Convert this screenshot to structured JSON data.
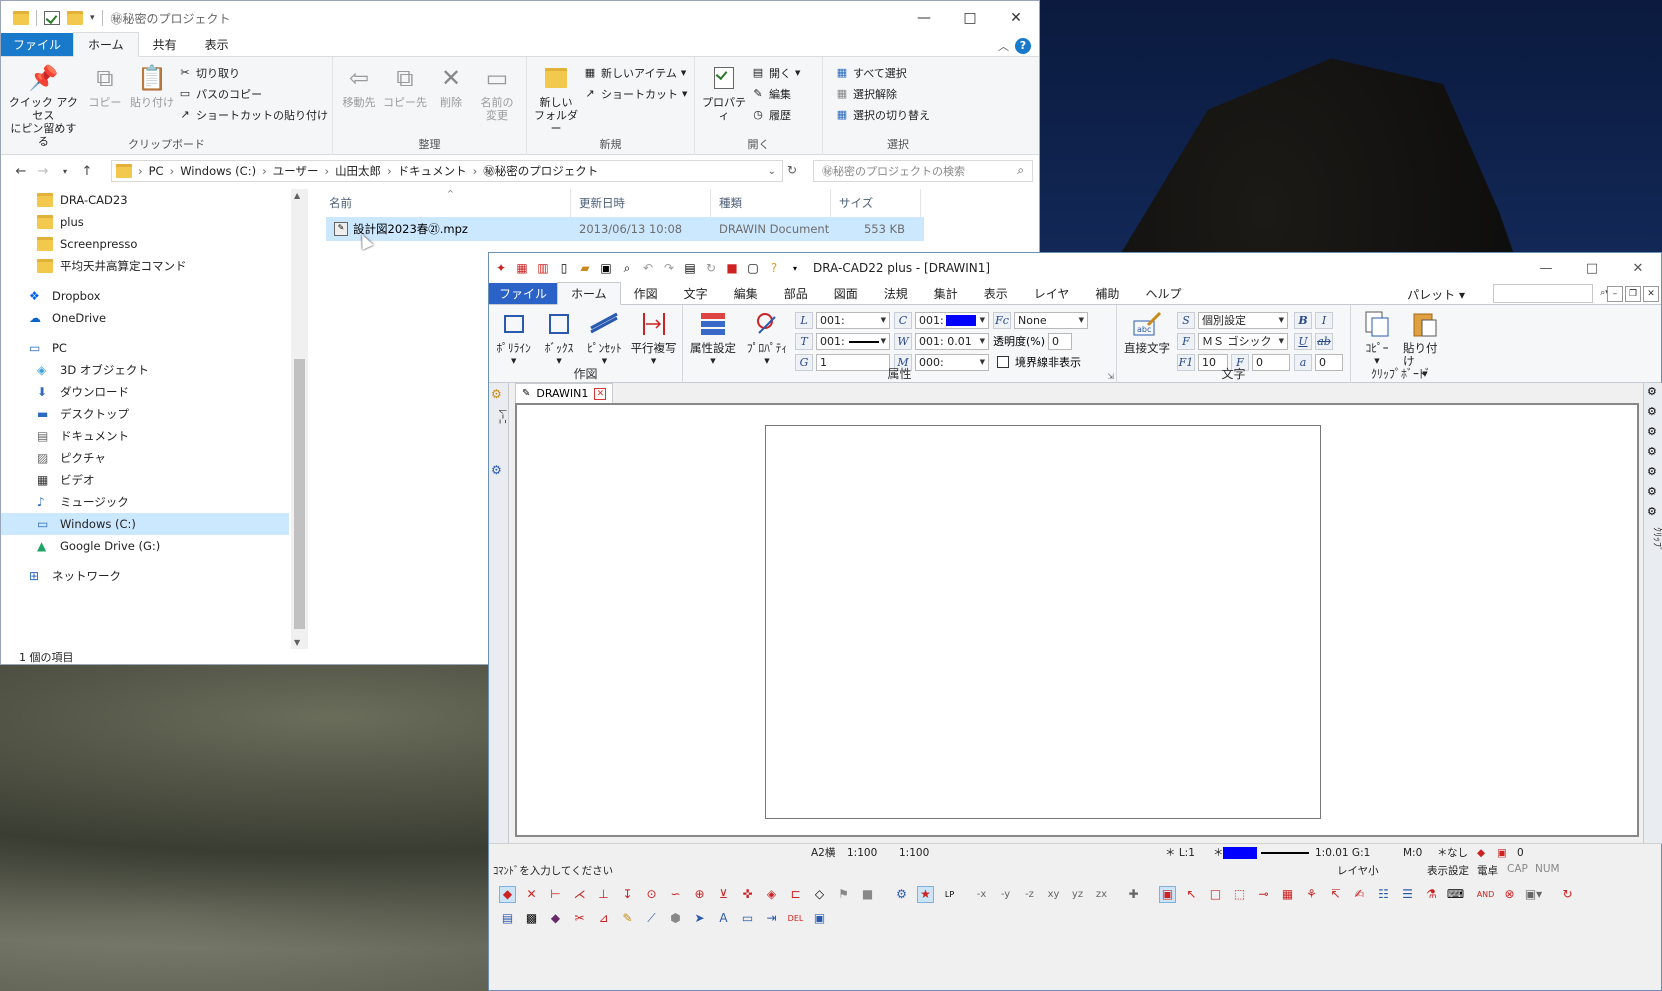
{
  "explorer": {
    "title": "㊙秘密のプロジェクト",
    "tabs": [
      "ファイル",
      "ホーム",
      "共有",
      "表示"
    ],
    "ribbon": {
      "clipboard": {
        "label": "クリップボード",
        "pin": "クイック アクセス\nにピン留めする",
        "copy": "コピー",
        "paste": "貼り付け",
        "cut": "切り取り",
        "copy_path": "パスのコピー",
        "paste_shortcut": "ショートカットの貼り付け"
      },
      "organize": {
        "label": "整理",
        "move_to": "移動先",
        "copy_to": "コピー先",
        "delete": "削除",
        "rename": "名前の\n変更"
      },
      "new": {
        "label": "新規",
        "new_folder": "新しい\nフォルダー",
        "new_item": "新しいアイテム",
        "shortcut": "ショートカット"
      },
      "open": {
        "label": "開く",
        "properties": "プロパティ",
        "open": "開く",
        "edit": "編集",
        "history": "履歴"
      },
      "select": {
        "label": "選択",
        "select_all": "すべて選択",
        "select_none": "選択解除",
        "invert": "選択の切り替え"
      }
    },
    "address": {
      "parts": [
        "PC",
        "Windows (C:)",
        "ユーザー",
        "山田太郎",
        "ドキュメント",
        "㊙秘密のプロジェクト"
      ]
    },
    "search_placeholder": "㊙秘密のプロジェクトの検索",
    "nav": [
      {
        "label": "DRA-CAD23",
        "icon": "folder-icon",
        "level": "child"
      },
      {
        "label": "plus",
        "icon": "folder-icon",
        "level": "child"
      },
      {
        "label": "Screenpresso",
        "icon": "folder-icon",
        "level": "child"
      },
      {
        "label": "平均天井高算定コマンド",
        "icon": "folder-icon",
        "level": "child"
      },
      {
        "label": "Dropbox",
        "icon": "dropbox-icon",
        "level": "top"
      },
      {
        "label": "OneDrive",
        "icon": "cloud-icon",
        "level": "top"
      },
      {
        "label": "PC",
        "icon": "pc-icon",
        "level": "top"
      },
      {
        "label": "3D オブジェクト",
        "icon": "cube-icon",
        "level": "child"
      },
      {
        "label": "ダウンロード",
        "icon": "download-icon",
        "level": "child"
      },
      {
        "label": "デスクトップ",
        "icon": "desktop-icon",
        "level": "child"
      },
      {
        "label": "ドキュメント",
        "icon": "document-icon",
        "level": "child"
      },
      {
        "label": "ピクチャ",
        "icon": "picture-icon",
        "level": "child"
      },
      {
        "label": "ビデオ",
        "icon": "video-icon",
        "level": "child"
      },
      {
        "label": "ミュージック",
        "icon": "music-icon",
        "level": "child"
      },
      {
        "label": "Windows (C:)",
        "icon": "drive-icon",
        "level": "child",
        "selected": true
      },
      {
        "label": "Google Drive (G:)",
        "icon": "google-drive-icon",
        "level": "child"
      },
      {
        "label": "ネットワーク",
        "icon": "network-icon",
        "level": "top"
      }
    ],
    "columns": [
      "名前",
      "更新日時",
      "種類",
      "サイズ"
    ],
    "files": [
      {
        "name": "設計図2023春㉑.mpz",
        "modified": "2013/06/13 10:08",
        "type": "DRAWIN Document",
        "size": "553 KB"
      }
    ],
    "status": "1 個の項目"
  },
  "cad": {
    "title": "DRA-CAD22 plus - [DRAWIN1]",
    "menu": [
      "ファイル",
      "ホーム",
      "作図",
      "文字",
      "編集",
      "部品",
      "図面",
      "法規",
      "集計",
      "表示",
      "レイヤ",
      "補助",
      "ヘルプ"
    ],
    "palette_label": "パレット",
    "ribbon": {
      "draw": {
        "label": "作図",
        "polyline": "ﾎﾟﾘﾗｲﾝ",
        "box": "ﾎﾞｯｸｽ",
        "pinset": "ﾋﾟﾝｾｯﾄ",
        "parallel": "平行複写"
      },
      "attr": {
        "label": "属性",
        "attr_settings": "属性設定",
        "properties": "ﾌﾟﾛﾊﾟﾃｨ",
        "L": "001:",
        "T": "001:",
        "G": "1",
        "C": "001:",
        "W": "001: 0.01",
        "M": "000:",
        "fc": "None",
        "transparency_label": "透明度(%)",
        "transparency": "0",
        "boundary": "境界線非表示"
      },
      "text": {
        "label": "文字",
        "direct": "直接文字",
        "style": "個別設定",
        "font": "ＭＳ ゴシック",
        "size": "10",
        "f2": "0",
        "f3": "0"
      },
      "clipboard": {
        "label": "ｸﾘｯﾌﾟﾎﾞｰﾄﾞ",
        "copy": "ｺﾋﾟｰ",
        "paste": "貼り付け"
      }
    },
    "doc_tab": "DRAWIN1",
    "left_label": "ﾚｰﾆ",
    "right_label": "ｸﾘｯﾌﾟ",
    "status1": {
      "paper": "A2横",
      "scale1": "1:100",
      "scale2": "1:100",
      "layer": "＊ L:1",
      "color": "＊",
      "lw": "1:0.01 G:1",
      "m": "M:0",
      "star2": "＊",
      "none": "なし",
      "zero": "0"
    },
    "status2": {
      "prompt": "ｺﾏﾝﾄﾞを入力してください",
      "layer_small": "レイヤ小",
      "display": "表示設定",
      "calc": "電卓",
      "cap": "CAP",
      "num": "NUM"
    },
    "colors": {
      "accent": "#2a62c8",
      "blue": "#0000ff"
    }
  }
}
